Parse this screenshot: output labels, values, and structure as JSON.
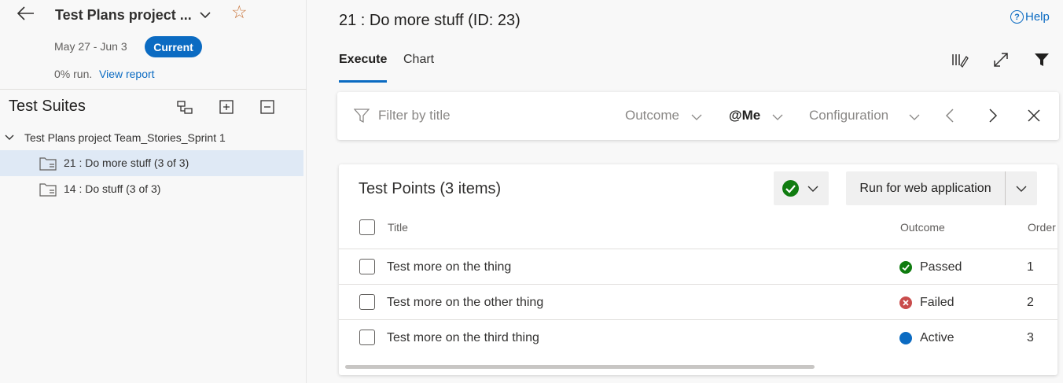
{
  "plan": {
    "title": "Test Plans project ...",
    "dates": "May 27 - Jun 3",
    "badge": "Current",
    "run_pct": "0% run.",
    "view_report": "View report"
  },
  "suites": {
    "title": "Test Suites",
    "root": "Test Plans project Team_Stories_Sprint 1",
    "items": [
      {
        "label": "21 : Do more stuff (3 of 3)",
        "selected": true
      },
      {
        "label": "14 : Do stuff (3 of 3)",
        "selected": false
      }
    ]
  },
  "main": {
    "heading": "21 : Do more stuff (ID: 23)",
    "help": "Help",
    "help_icon": "?",
    "tabs": [
      {
        "label": "Execute",
        "active": true
      },
      {
        "label": "Chart",
        "active": false
      }
    ]
  },
  "filter": {
    "placeholder": "Filter by title",
    "outcome": "Outcome",
    "assignee": "@Me",
    "configuration": "Configuration"
  },
  "points": {
    "title": "Test Points (3 items)",
    "run_button": "Run for web application",
    "columns": {
      "title": "Title",
      "outcome": "Outcome",
      "order": "Order"
    },
    "rows": [
      {
        "title": "Test more on the thing",
        "outcome": "Passed",
        "order": "1",
        "status": "passed"
      },
      {
        "title": "Test more on the other thing",
        "outcome": "Failed",
        "order": "2",
        "status": "failed"
      },
      {
        "title": "Test more on the third thing",
        "outcome": "Active",
        "order": "3",
        "status": "active"
      }
    ]
  },
  "colors": {
    "accent": "#0b6bc2",
    "passed": "#107c10",
    "failed": "#c94c4c",
    "active": "#0b6bc2",
    "star": "#c8743a"
  }
}
